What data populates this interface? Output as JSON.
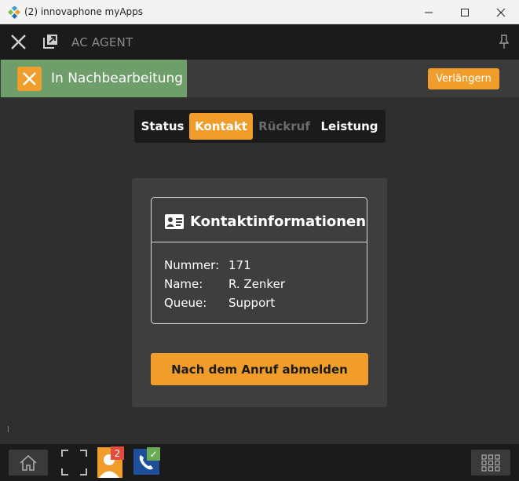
{
  "window": {
    "title": "(2) innovaphone myApps"
  },
  "header": {
    "app_name": "AC AGENT"
  },
  "status": {
    "text": "In Nachbearbeitung",
    "extend_label": "Verlängern"
  },
  "tabs": [
    {
      "label": "Status",
      "state": "normal"
    },
    {
      "label": "Kontakt",
      "state": "active"
    },
    {
      "label": "Rückruf",
      "state": "disabled"
    },
    {
      "label": "Leistung",
      "state": "normal"
    }
  ],
  "contact": {
    "title": "Kontaktinformationen",
    "rows": [
      {
        "label": "Nummer:",
        "value": "171"
      },
      {
        "label": "Name:",
        "value": "R. Zenker"
      },
      {
        "label": "Queue:",
        "value": "Support"
      }
    ],
    "logout_label": "Nach dem Anruf abmelden"
  },
  "taskbar": {
    "agent_badge": "2",
    "phone_status": "✓"
  },
  "colors": {
    "accent": "#f19d2b",
    "status_green": "#6e9e6a",
    "badge_red": "#e54b3c",
    "check_green": "#6aab54"
  }
}
